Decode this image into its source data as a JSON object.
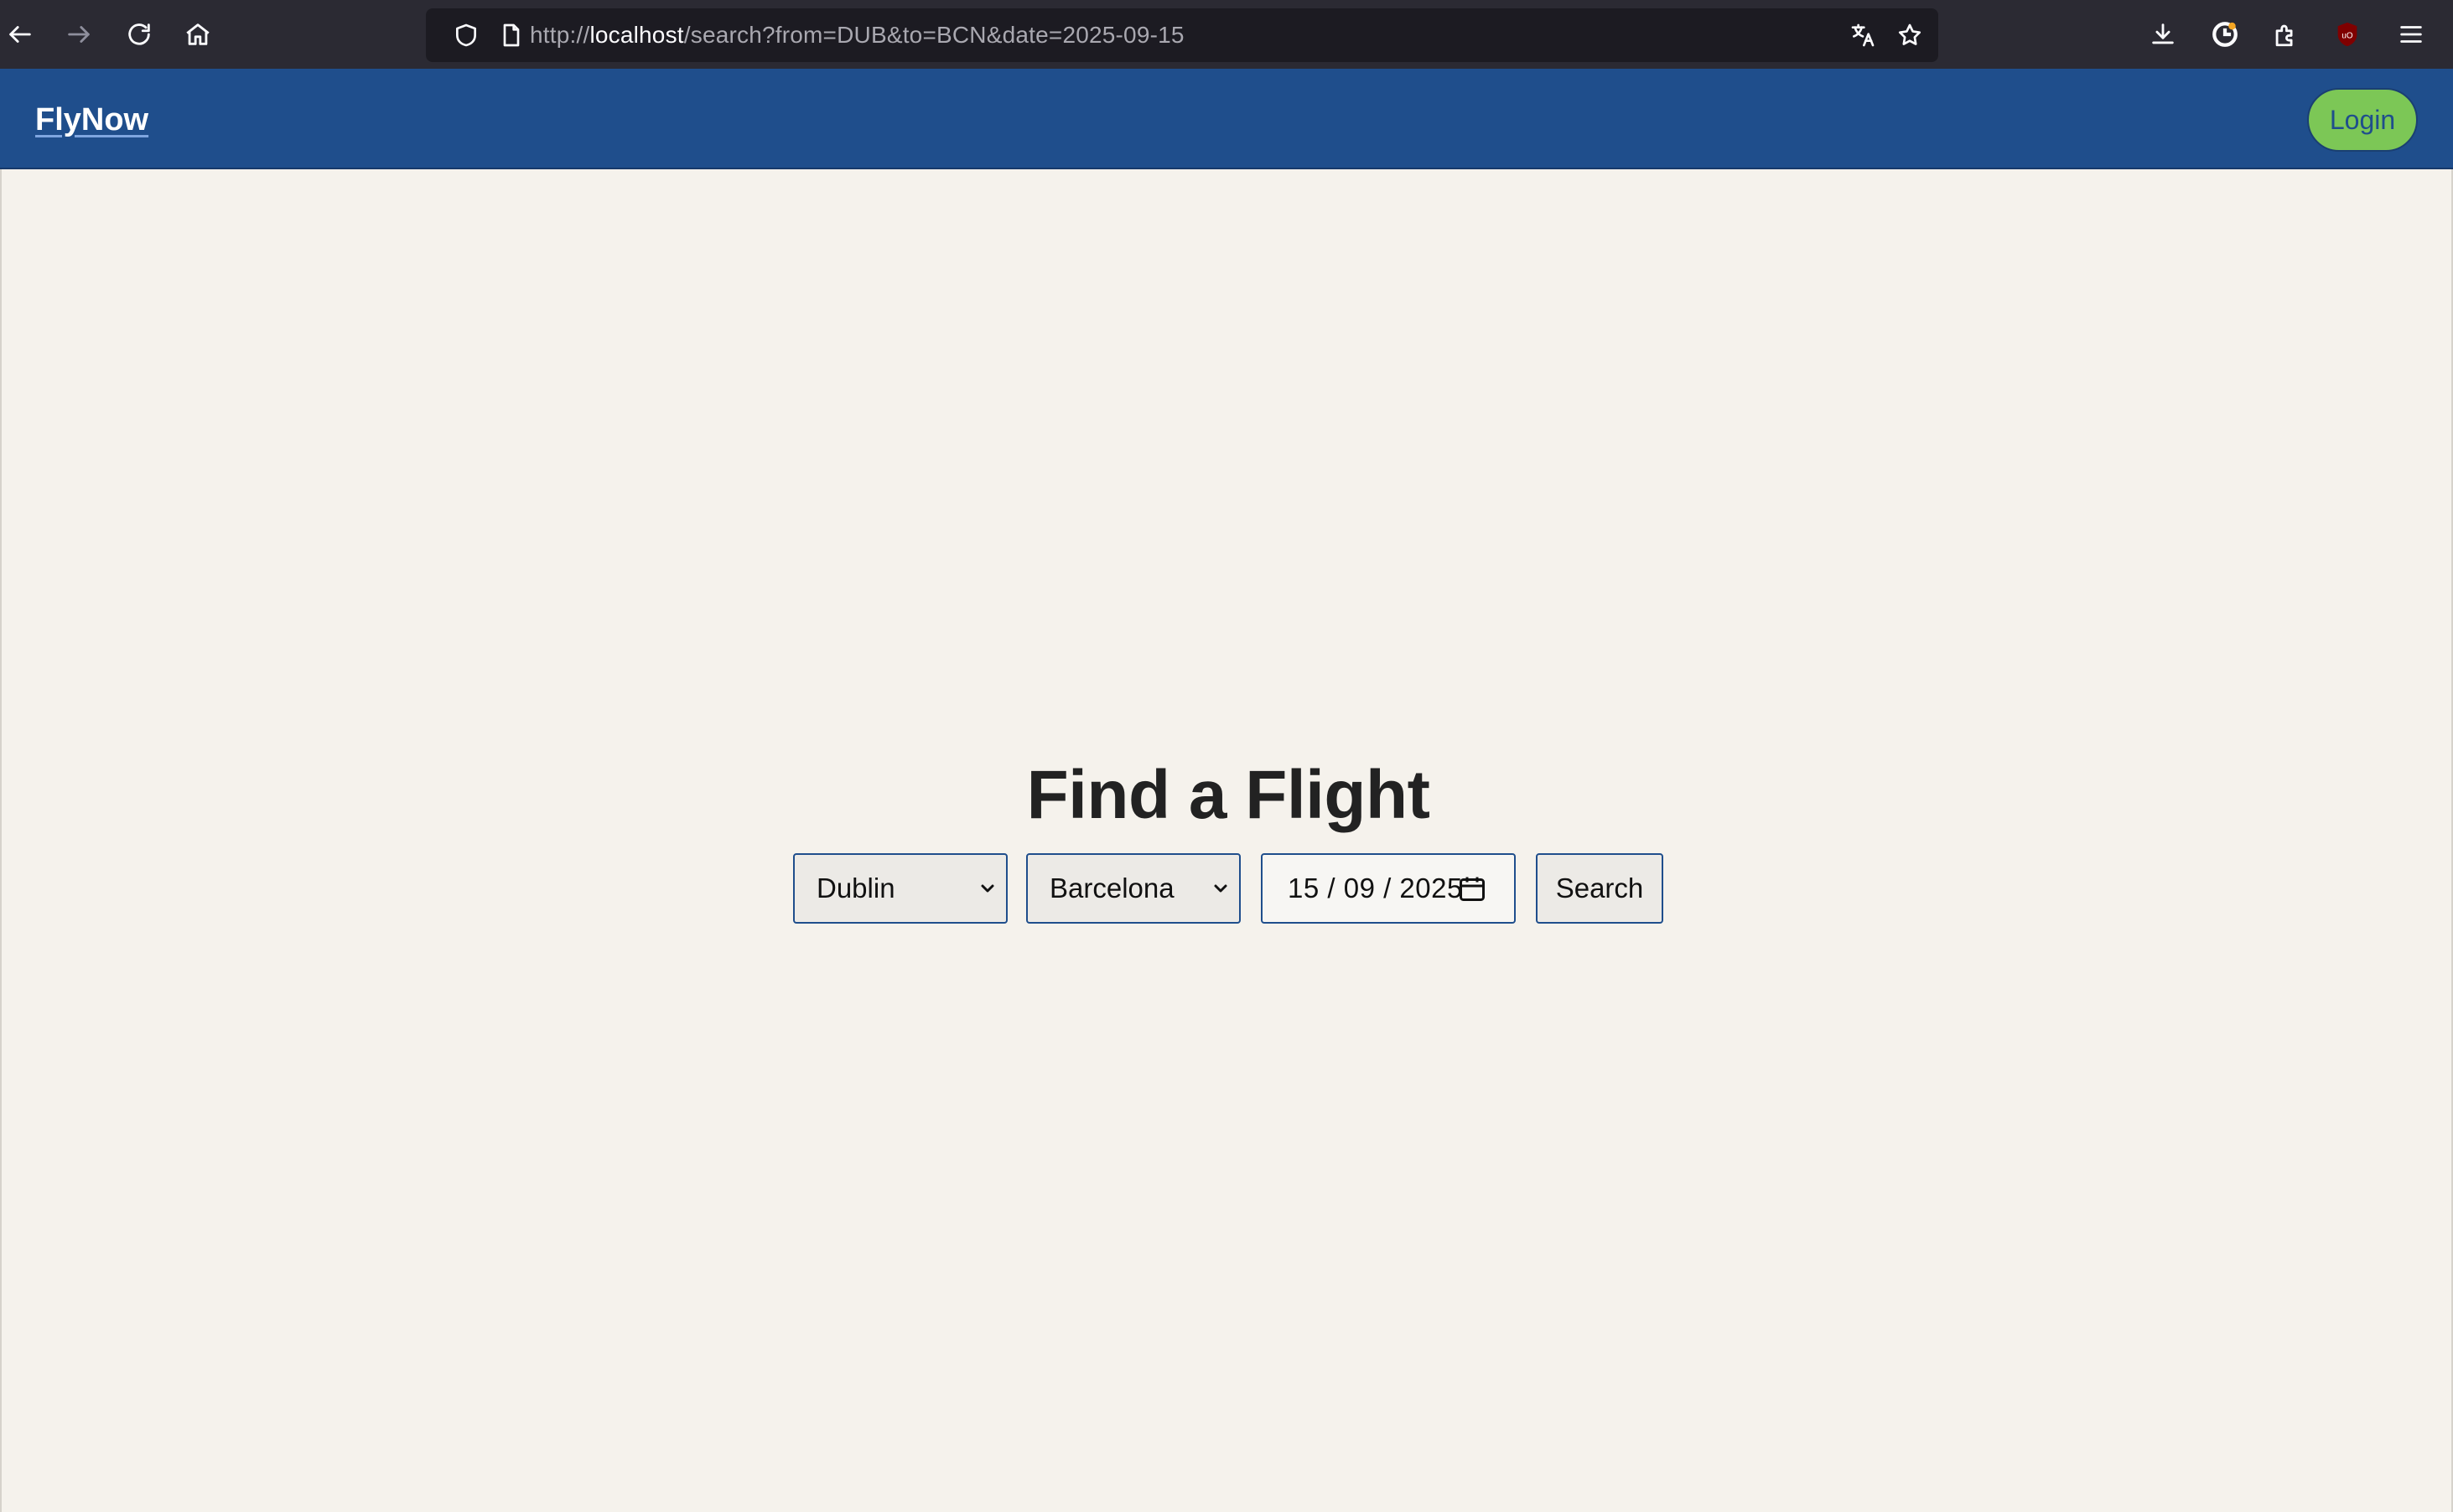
{
  "browser": {
    "url_prefix": "http://",
    "url_host": "localhost",
    "url_path": "/search?from=DUB&to=BCN&date=2025-09-15",
    "icons": {
      "back": "back-arrow-icon",
      "forward": "forward-arrow-icon",
      "reload": "reload-icon",
      "home": "home-icon",
      "tracking": "shield-icon",
      "page": "page-icon",
      "translate": "translate-icon",
      "bookmark": "star-icon",
      "downloads": "download-icon",
      "account": "account-icon",
      "extensions": "puzzle-icon",
      "ublock": "ublock-icon",
      "menu": "hamburger-menu-icon"
    }
  },
  "header": {
    "brand": "FlyNow",
    "login_label": "Login"
  },
  "main": {
    "title": "Find a Flight",
    "from_value": "Dublin",
    "to_value": "Barcelona",
    "date_value": "15 / 09 / 2025",
    "search_label": "Search"
  },
  "colors": {
    "header_bg": "#1f4e8c",
    "page_bg": "#f5f2ec",
    "login_bg": "#7cc756",
    "browser_bg": "#2b2a33",
    "urlbar_bg": "#1c1b22"
  }
}
